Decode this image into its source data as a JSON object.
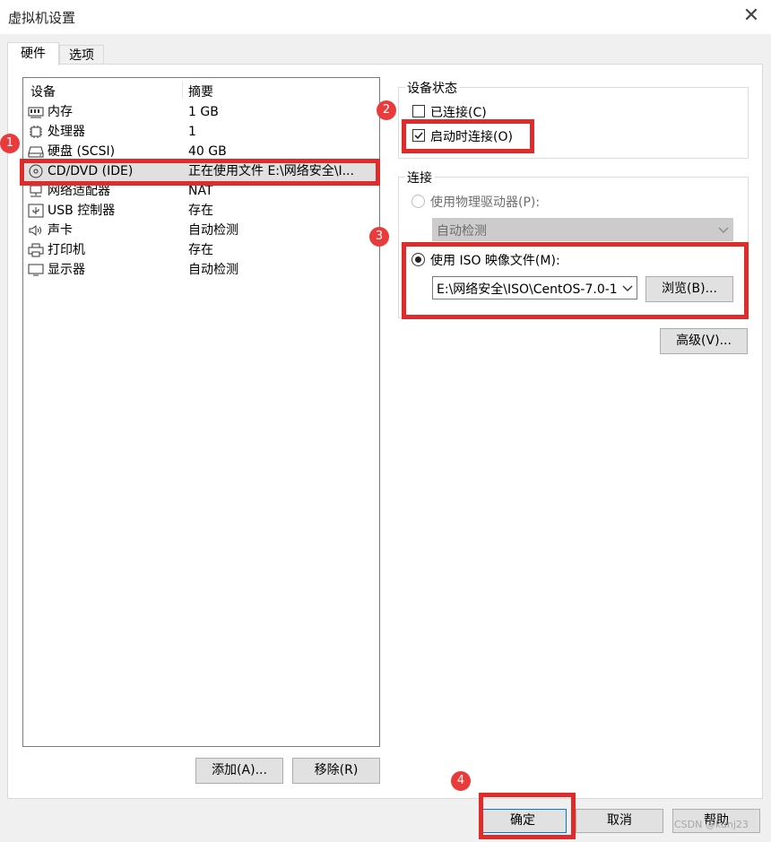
{
  "window": {
    "title": "虚拟机设置",
    "close_glyph": "✕"
  },
  "tabs": [
    {
      "label": "硬件"
    },
    {
      "label": "选项"
    }
  ],
  "device_list": {
    "headers": {
      "device": "设备",
      "summary": "摘要"
    },
    "rows": [
      {
        "name": "内存",
        "summary": "1 GB",
        "icon": "memory-icon"
      },
      {
        "name": "处理器",
        "summary": "1",
        "icon": "cpu-icon"
      },
      {
        "name": "硬盘 (SCSI)",
        "summary": "40 GB",
        "icon": "harddisk-icon"
      },
      {
        "name": "CD/DVD (IDE)",
        "summary": "正在使用文件 E:\\网络安全\\I...",
        "icon": "cd-dvd-icon",
        "selected": true
      },
      {
        "name": "网络适配器",
        "summary": "NAT",
        "icon": "network-adapter-icon"
      },
      {
        "name": "USB 控制器",
        "summary": "存在",
        "icon": "usb-icon"
      },
      {
        "name": "声卡",
        "summary": "自动检测",
        "icon": "speaker-icon"
      },
      {
        "name": "打印机",
        "summary": "存在",
        "icon": "printer-icon"
      },
      {
        "name": "显示器",
        "summary": "自动检测",
        "icon": "monitor-icon"
      }
    ],
    "add_button": "添加(A)...",
    "remove_button": "移除(R)"
  },
  "device_status": {
    "title": "设备状态",
    "connected_label": "已连接(C)",
    "connected": false,
    "connect_at_power_on_label": "启动时连接(O)",
    "connect_at_power_on": true
  },
  "connection": {
    "title": "连接",
    "physical_drive_label": "使用物理驱动器(P):",
    "physical_drive_value": "自动检测",
    "iso_label": "使用 ISO 映像文件(M):",
    "iso_selected": true,
    "iso_path": "E:\\网络安全\\ISO\\CentOS-7.0-1",
    "browse_button": "浏览(B)...",
    "advanced_button": "高级(V)..."
  },
  "footer": {
    "ok": "确定",
    "cancel": "取消",
    "help": "帮助"
  },
  "annotations": {
    "badges": [
      "1",
      "2",
      "3",
      "4"
    ],
    "color": "#e02b2b"
  },
  "watermark": "CSDN @kunj23"
}
